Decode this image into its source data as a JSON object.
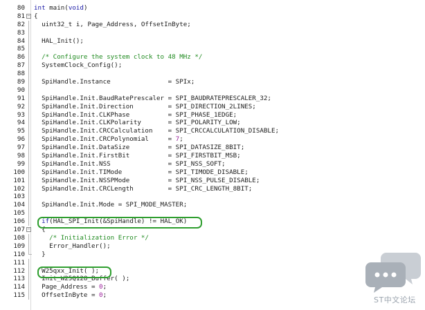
{
  "lines": [
    {
      "n": "80",
      "code": "int main(void)"
    },
    {
      "n": "81",
      "code": "{"
    },
    {
      "n": "82",
      "code": "  uint32_t i, Page_Address, OffsetInByte;"
    },
    {
      "n": "83",
      "code": ""
    },
    {
      "n": "84",
      "code": "  HAL_Init();"
    },
    {
      "n": "85",
      "code": ""
    },
    {
      "n": "86",
      "code": "  /* Configure the system clock to 48 MHz */"
    },
    {
      "n": "87",
      "code": "  SystemClock_Config();"
    },
    {
      "n": "88",
      "code": ""
    },
    {
      "n": "89",
      "code": "  SpiHandle.Instance               = SPIx;"
    },
    {
      "n": "90",
      "code": ""
    },
    {
      "n": "91",
      "code": "  SpiHandle.Init.BaudRatePrescaler = SPI_BAUDRATEPRESCALER_32;"
    },
    {
      "n": "92",
      "code": "  SpiHandle.Init.Direction         = SPI_DIRECTION_2LINES;"
    },
    {
      "n": "93",
      "code": "  SpiHandle.Init.CLKPhase          = SPI_PHASE_1EDGE;"
    },
    {
      "n": "94",
      "code": "  SpiHandle.Init.CLKPolarity       = SPI_POLARITY_LOW;"
    },
    {
      "n": "95",
      "code": "  SpiHandle.Init.CRCCalculation    = SPI_CRCCALCULATION_DISABLE;"
    },
    {
      "n": "96",
      "code": "  SpiHandle.Init.CRCPolynomial     = 7;"
    },
    {
      "n": "97",
      "code": "  SpiHandle.Init.DataSize          = SPI_DATASIZE_8BIT;"
    },
    {
      "n": "98",
      "code": "  SpiHandle.Init.FirstBit          = SPI_FIRSTBIT_MSB;"
    },
    {
      "n": "99",
      "code": "  SpiHandle.Init.NSS               = SPI_NSS_SOFT;"
    },
    {
      "n": "100",
      "code": "  SpiHandle.Init.TIMode            = SPI_TIMODE_DISABLE;"
    },
    {
      "n": "101",
      "code": "  SpiHandle.Init.NSSPMode          = SPI_NSS_PULSE_DISABLE;"
    },
    {
      "n": "102",
      "code": "  SpiHandle.Init.CRCLength         = SPI_CRC_LENGTH_8BIT;"
    },
    {
      "n": "103",
      "code": ""
    },
    {
      "n": "104",
      "code": "  SpiHandle.Init.Mode = SPI_MODE_MASTER;"
    },
    {
      "n": "105",
      "code": ""
    },
    {
      "n": "106",
      "code": "  if(HAL_SPI_Init(&SpiHandle) != HAL_OK)"
    },
    {
      "n": "107",
      "code": "  {"
    },
    {
      "n": "108",
      "code": "    /* Initialization Error */"
    },
    {
      "n": "109",
      "code": "    Error_Handler();"
    },
    {
      "n": "110",
      "code": "  }"
    },
    {
      "n": "111",
      "code": ""
    },
    {
      "n": "112",
      "code": "  W25qxx_Init( );"
    },
    {
      "n": "113",
      "code": "  Init_W25Q128_Buffer( );"
    },
    {
      "n": "114",
      "code": "  Page_Address = 0;"
    },
    {
      "n": "115",
      "code": "  OffsetInByte = 0;"
    }
  ],
  "watermark": {
    "text": "ST中文论坛",
    "color": "#9aa3ad"
  },
  "colors": {
    "keyword": "#1a1aa6",
    "comment": "#1f8a1f",
    "number": "#9a1f9a",
    "highlight": "#2e9e2e"
  }
}
